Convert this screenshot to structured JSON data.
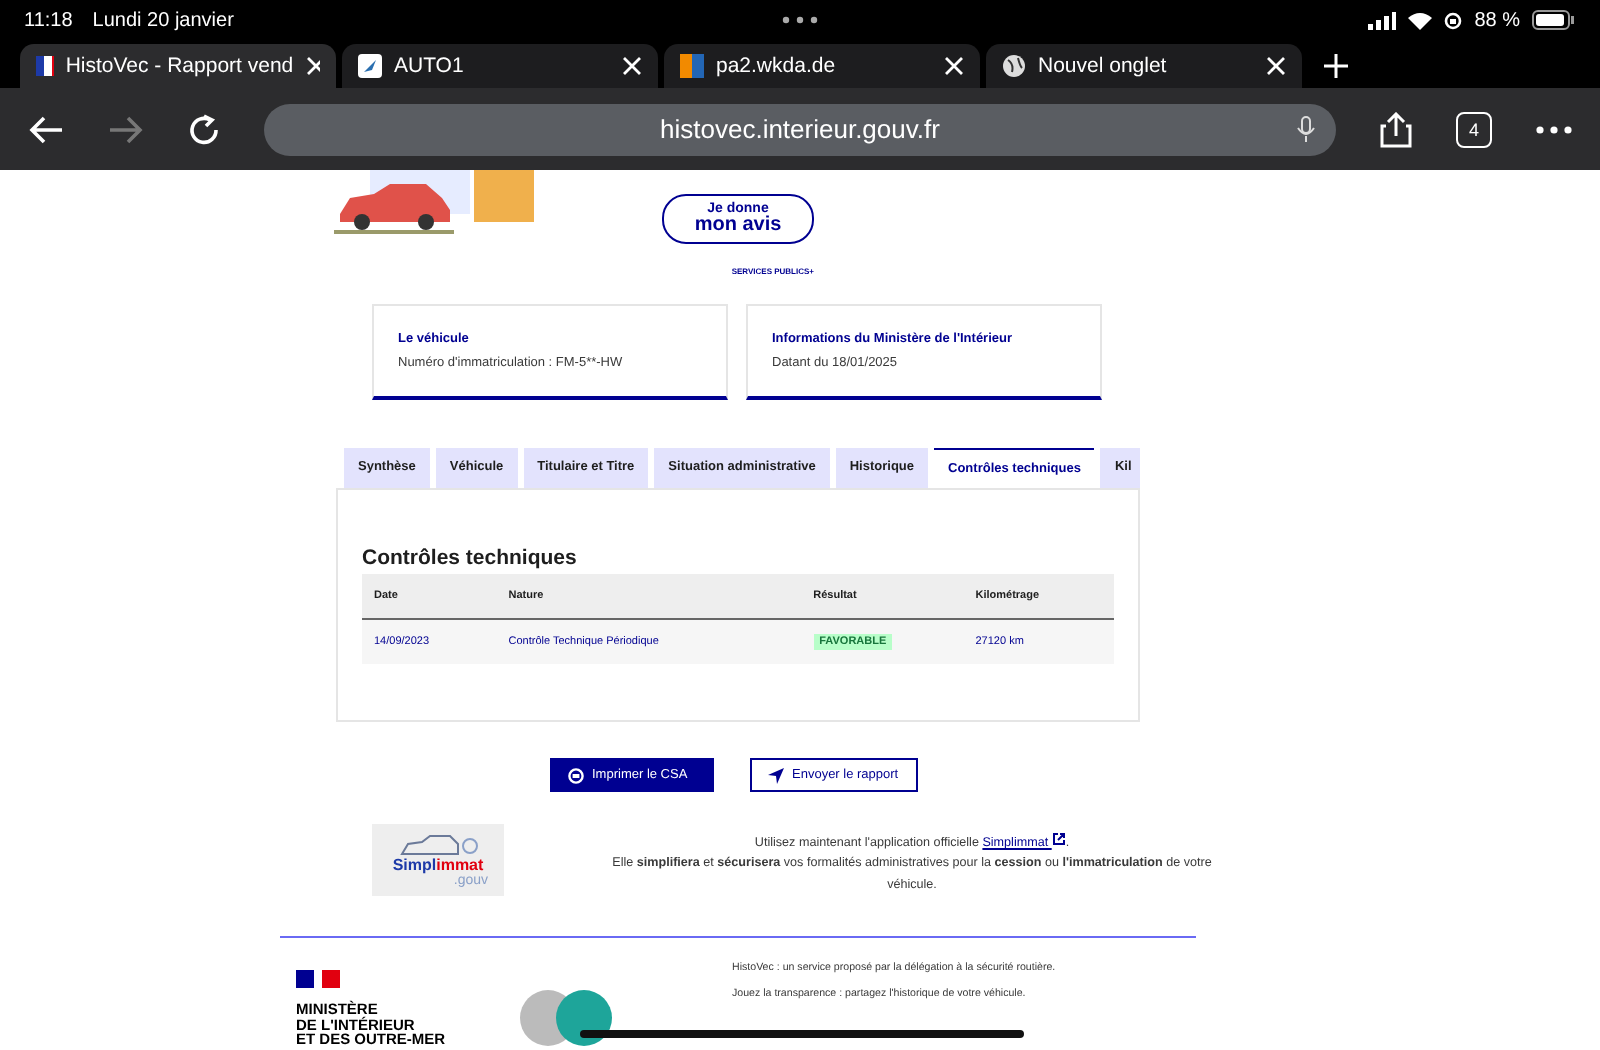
{
  "status_bar": {
    "time": "11:18",
    "date": "Lundi 20 janvier",
    "battery": "88 %"
  },
  "browser_tabs": [
    {
      "title": "HistoVec - Rapport vend",
      "selected": true
    },
    {
      "title": "AUTO1",
      "selected": false
    },
    {
      "title": "pa2.wkda.de",
      "selected": false
    },
    {
      "title": "Nouvel onglet",
      "selected": false
    }
  ],
  "toolbar": {
    "url": "histovec.interieur.gouv.fr",
    "tab_count": "4"
  },
  "feedback": {
    "line1": "Je donne",
    "line2": "mon avis",
    "brand": "SERVICES PUBLICS+"
  },
  "cards": [
    {
      "title": "Le véhicule",
      "text": "Numéro d'immatriculation : FM-5**-HW"
    },
    {
      "title": "Informations du Ministère de l'Intérieur",
      "text": "Datant du 18/01/2025"
    }
  ],
  "tabs": [
    {
      "label": "Synthèse",
      "selected": false
    },
    {
      "label": "Véhicule",
      "selected": false
    },
    {
      "label": "Titulaire et Titre",
      "selected": false
    },
    {
      "label": "Situation administrative",
      "selected": false
    },
    {
      "label": "Historique",
      "selected": false
    },
    {
      "label": "Contrôles techniques",
      "selected": true
    },
    {
      "label": "Kil",
      "selected": false
    }
  ],
  "section_title": "Contrôles techniques",
  "table": {
    "columns": [
      "Date",
      "Nature",
      "Résultat",
      "Kilométrage"
    ],
    "rows": [
      {
        "date": "14/09/2023",
        "nature": "Contrôle Technique Périodique",
        "result": "FAVORABLE",
        "mileage": "27120 km"
      }
    ]
  },
  "buttons": [
    {
      "label": "Imprimer le CSA",
      "kind": "primary"
    },
    {
      "label": "Envoyer le rapport",
      "kind": "secondary"
    }
  ],
  "simplimmat": {
    "logo_a": "Simpl",
    "logo_b": "immat",
    "logo_c": ".gouv",
    "intro": "Utilisez maintenant l'application officielle",
    "link": "Simplimmat",
    "after": ".",
    "body": "Elle **simplifiera** et **sécurisera** vos formalités administratives pour la **cession** ou **l'immatriculation** de votre véhicule."
  },
  "footer": {
    "ministry": [
      "MINISTÈRE",
      "DE L'INTÉRIEUR",
      "ET DES OUTRE-MER"
    ],
    "lines": [
      "HistoVec : un service proposé par la délégation à la sécurité routière.",
      "Jouez la transparence : partagez l'historique de votre véhicule."
    ]
  }
}
